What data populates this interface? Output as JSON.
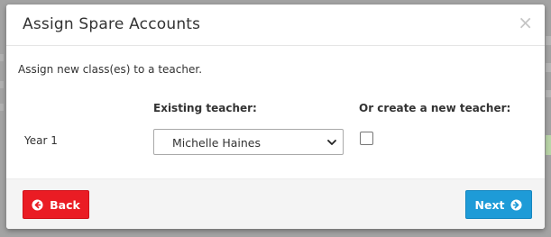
{
  "modal": {
    "title": "Assign Spare Accounts",
    "close_glyph": "×",
    "intro": "Assign new class(es) to a teacher.",
    "columns": {
      "existing_teacher": "Existing teacher:",
      "new_teacher": "Or create a new teacher:"
    },
    "rows": [
      {
        "label": "Year 1",
        "selected_teacher": "Michelle Haines",
        "create_new_checked": false
      }
    ],
    "buttons": {
      "back": {
        "label": "Back",
        "icon": "arrow-circle-left-icon",
        "color": "#ea1c24"
      },
      "next": {
        "label": "Next",
        "icon": "arrow-circle-right-icon",
        "color": "#1e9bd7"
      }
    }
  }
}
